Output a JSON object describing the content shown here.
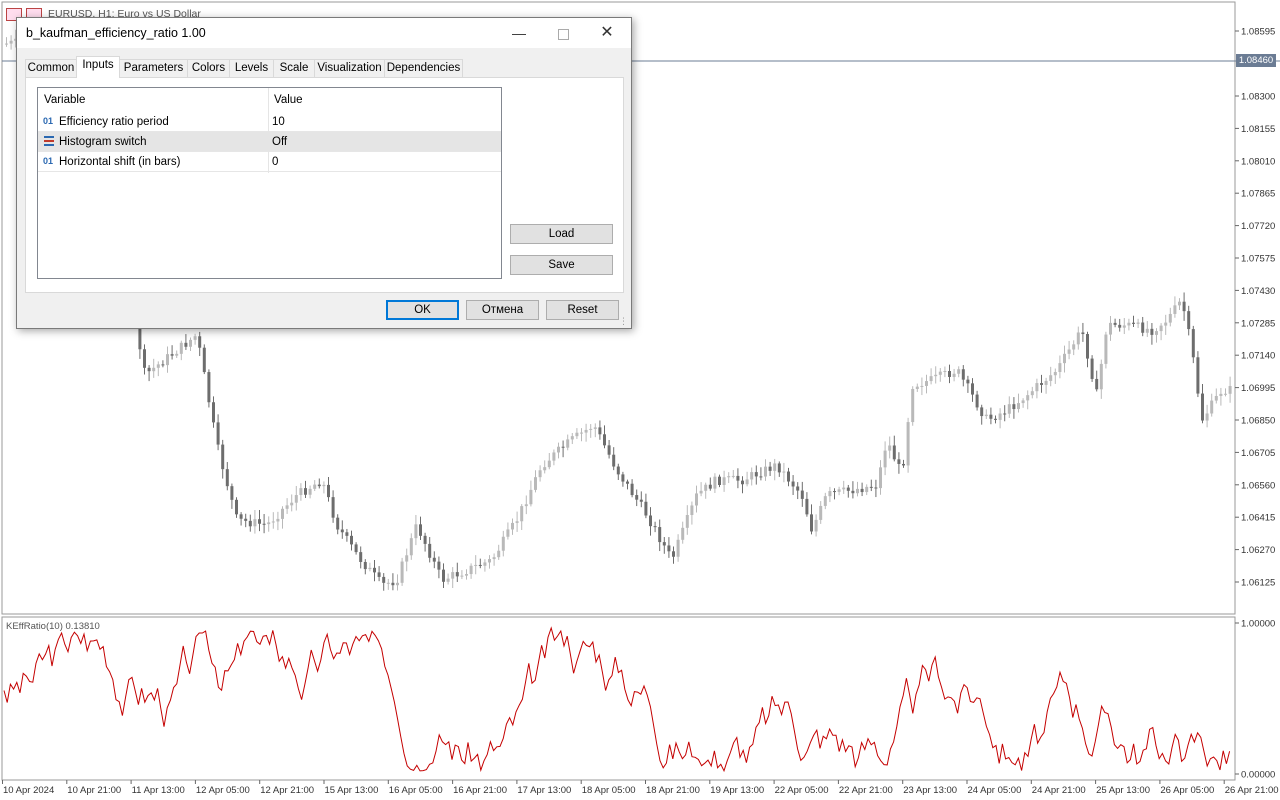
{
  "chart": {
    "title": "EURUSD, H1:  Euro vs US Dollar",
    "current_price": "1.08460",
    "price_axis": [
      "1.08595",
      "1.08300",
      "1.08155",
      "1.08010",
      "1.07865",
      "1.07720",
      "1.07575",
      "1.07430",
      "1.07285",
      "1.07140",
      "1.06995",
      "1.06850",
      "1.06705",
      "1.06560",
      "1.06415",
      "1.06270",
      "1.06125"
    ],
    "indicator_label": "KEffRatio(10) 0.13810",
    "indicator_axis": [
      "1.00000",
      "0.00000"
    ],
    "time_axis": [
      "10 Apr 2024",
      "10 Apr 21:00",
      "11 Apr 13:00",
      "12 Apr 05:00",
      "12 Apr 21:00",
      "15 Apr 13:00",
      "16 Apr 05:00",
      "16 Apr 21:00",
      "17 Apr 13:00",
      "18 Apr 05:00",
      "18 Apr 21:00",
      "19 Apr 13:00",
      "22 Apr 05:00",
      "22 Apr 21:00",
      "23 Apr 13:00",
      "24 Apr 05:00",
      "24 Apr 21:00",
      "25 Apr 13:00",
      "26 Apr 05:00",
      "26 Apr 21:00"
    ],
    "colors": {
      "bull": "#b9b9b9",
      "bear": "#6d6d6d",
      "indicator": "#c40000",
      "grid": "#9a9a9a"
    }
  },
  "dialog": {
    "title": "b_kaufman_efficiency_ratio 1.00",
    "tabs": [
      "Common",
      "Inputs",
      "Parameters",
      "Colors",
      "Levels",
      "Scale",
      "Visualization",
      "Dependencies"
    ],
    "active_tab": "Inputs",
    "grid": {
      "headers": [
        "Variable",
        "Value"
      ],
      "rows": [
        {
          "icon": "01",
          "name": "Efficiency ratio period",
          "value": "10"
        },
        {
          "icon": "enum-icon",
          "name": "Histogram switch",
          "value": "Off"
        },
        {
          "icon": "01",
          "name": "Horizontal shift (in bars)",
          "value": "0"
        }
      ]
    },
    "load_label": "Load",
    "save_label": "Save",
    "ok_label": "OK",
    "cancel_label": "Отмена",
    "reset_label": "Reset"
  }
}
